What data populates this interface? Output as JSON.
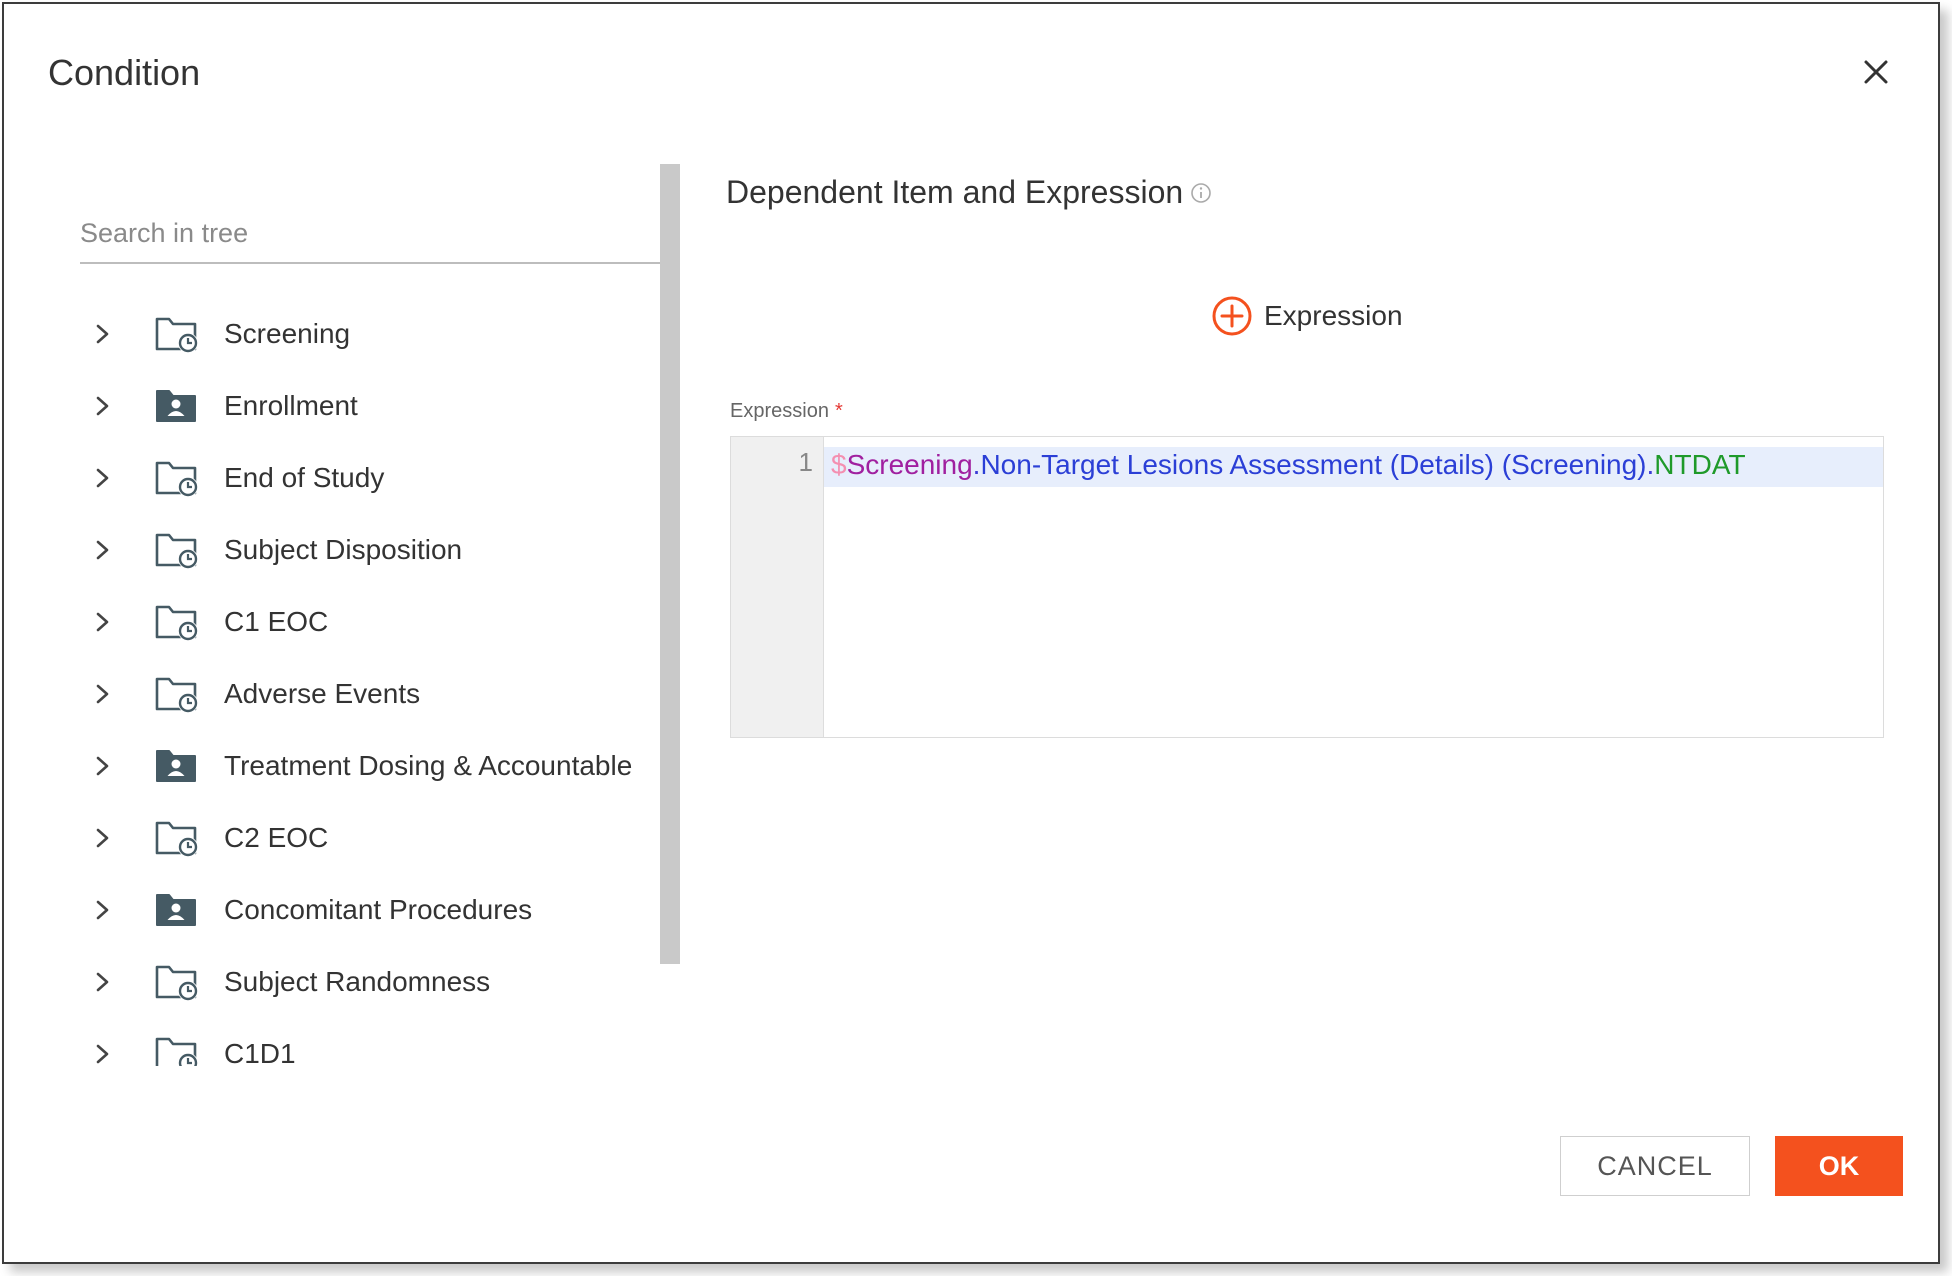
{
  "dialog": {
    "title": "Condition"
  },
  "tree": {
    "search_placeholder": "Search in tree",
    "items": [
      {
        "label": "Screening",
        "icon": "folder-clock-icon"
      },
      {
        "label": "Enrollment",
        "icon": "folder-person-icon"
      },
      {
        "label": "End of Study",
        "icon": "folder-clock-icon"
      },
      {
        "label": "Subject Disposition",
        "icon": "folder-clock-icon"
      },
      {
        "label": "C1 EOC",
        "icon": "folder-clock-icon"
      },
      {
        "label": "Adverse Events",
        "icon": "folder-clock-icon"
      },
      {
        "label": "Treatment Dosing & Accountable",
        "icon": "folder-person-icon"
      },
      {
        "label": "C2 EOC",
        "icon": "folder-clock-icon"
      },
      {
        "label": "Concomitant Procedures",
        "icon": "folder-person-icon"
      },
      {
        "label": "Subject Randomness",
        "icon": "folder-clock-icon"
      },
      {
        "label": "C1D1",
        "icon": "folder-clock-icon"
      }
    ]
  },
  "main": {
    "section_title": "Dependent Item and Expression",
    "add_expression_label": "Expression",
    "expression_label": "Expression",
    "required_marker": "*",
    "editor": {
      "line_number": "1",
      "tokens": {
        "dollar": "$",
        "event": "Screening",
        "dot1": ".",
        "form": "Non-Target Lesions Assessment (Details) (Screening)",
        "dot2": ".",
        "item": "NTDAT"
      }
    }
  },
  "footer": {
    "cancel_label": "CANCEL",
    "ok_label": "OK"
  },
  "colors": {
    "accent": "#f4511e",
    "tree_icon": "#455a64"
  }
}
